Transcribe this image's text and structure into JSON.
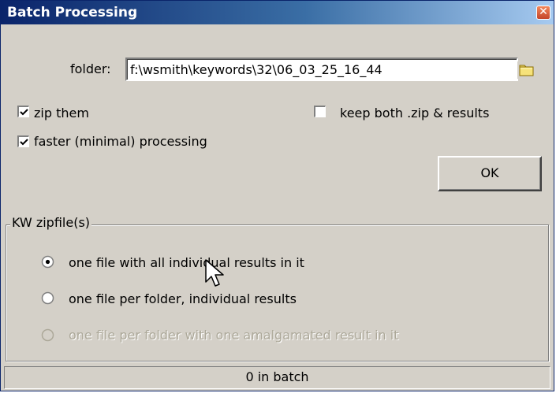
{
  "window": {
    "title": "Batch Processing",
    "close_glyph": "✕"
  },
  "folder": {
    "label": "folder:",
    "value": "f:\\wsmith\\keywords\\32\\06_03_25_16_44",
    "browse_icon": "folder-icon"
  },
  "options": {
    "zip_them": {
      "label": "zip them",
      "checked": true
    },
    "faster": {
      "label": "faster (minimal) processing",
      "checked": true
    },
    "keep_both": {
      "label": "keep both .zip & results",
      "checked": false
    }
  },
  "ok_button": {
    "label": "OK"
  },
  "kw_group": {
    "legend": "KW zipfile(s)",
    "options": [
      {
        "label": "one file with all individual results in it",
        "selected": true,
        "enabled": true
      },
      {
        "label": "one file per folder, individual results",
        "selected": false,
        "enabled": true
      },
      {
        "label": "one file per folder with one amalgamated result in it",
        "selected": false,
        "enabled": false
      }
    ]
  },
  "status": {
    "text": "0 in batch"
  },
  "colors": {
    "titlebar": "#0a246a",
    "face": "#d4d0c8",
    "close": "#e15e3a",
    "disabled_text": "#aca899"
  }
}
